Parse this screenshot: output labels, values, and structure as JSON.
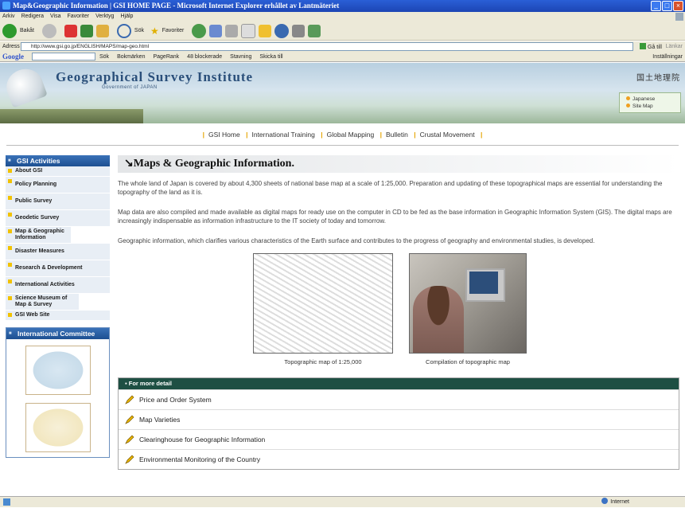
{
  "window": {
    "title": "Map&Geographic Information | GSI HOME PAGE - Microsoft Internet Explorer erhållet av Lantmäteriet"
  },
  "menu": [
    "Arkiv",
    "Redigera",
    "Visa",
    "Favoriter",
    "Verktyg",
    "Hjälp"
  ],
  "toolbar": {
    "back_label": "Bakåt",
    "search_label": "Sök",
    "favorites_label": "Favoriter"
  },
  "address": {
    "label": "Adress",
    "url": "http://www.gsi.go.jp/ENGLISH/MAPS/map-geo.html",
    "go_label": "Gå till",
    "links_label": "Länkar"
  },
  "googlebar": {
    "logo": "Google",
    "items": [
      "Sök",
      "Bokmärken",
      "PageRank",
      "48 blockerade",
      "Stavning",
      "Skicka till"
    ],
    "settings_label": "Inställningar"
  },
  "banner": {
    "title": "Geographical Survey Institute",
    "subtitle": "Government of JAPAN",
    "japanese_name": "国土地理院",
    "lang_links": [
      "Japanese",
      "Site Map"
    ]
  },
  "topnav": [
    "GSI Home",
    "International Training",
    "Global Mapping",
    "Bulletin",
    "Crustal Movement"
  ],
  "sidebar": {
    "heading": "GSI Activities",
    "items": [
      "About GSI",
      "Policy Planning",
      "Public Survey",
      "Geodetic Survey",
      "Map & Geographic Information",
      "Disaster Measures",
      "Research & Development",
      "International Activities",
      "Science Museum of Map & Survey",
      "GSI Web Site"
    ],
    "committee_heading": "International Committee"
  },
  "main": {
    "title": "Maps & Geographic Information.",
    "paragraphs": [
      "The whole land of Japan is covered by about 4,300 sheets of national base map at a scale of 1:25,000. Preparation and updating of these topographical maps are essential for understanding the topography of the land as it is.",
      "Map data are also compiled and made available as digital maps for ready use on the computer in CD to be fed as the base information in Geographic Information System (GIS). The digital maps are increasingly indispensable as information infrastructure to the IT society of today and tomorrow.",
      "Geographic information, which clarifies various characteristics of the Earth surface and contributes to the progress of geography and environmental studies, is developed."
    ],
    "captions": [
      "Topographic map of 1:25,000",
      "Compilation of topographic map"
    ],
    "detail_heading": "For more detail",
    "detail_links": [
      "Price and Order System",
      "Map Varieties",
      "Clearinghouse for Geographic Information",
      "Environmental Monitoring of the Country"
    ]
  },
  "status": {
    "zone": "Internet"
  },
  "colors": {
    "title_bar": "#1c45b4",
    "sidebar_head": "#1d4f91",
    "detail_head": "#1e4f43",
    "nav_separator": "#e6a400"
  }
}
